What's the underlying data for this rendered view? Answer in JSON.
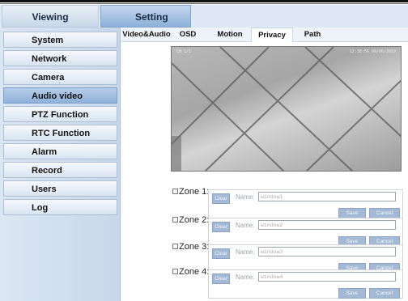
{
  "top_tabs": [
    {
      "label": "Viewing"
    },
    {
      "label": "Setting"
    }
  ],
  "sidebar": {
    "items": [
      {
        "label": "System"
      },
      {
        "label": "Network"
      },
      {
        "label": "Camera"
      },
      {
        "label": "Audio video",
        "active": true
      },
      {
        "label": "PTZ Function"
      },
      {
        "label": "RTC Function"
      },
      {
        "label": "Alarm"
      },
      {
        "label": "Record"
      },
      {
        "label": "Users"
      },
      {
        "label": "Log"
      }
    ]
  },
  "sub_tabs": [
    {
      "label": "Video&Audio"
    },
    {
      "label": "OSD"
    },
    {
      "label": "Motion"
    },
    {
      "label": "Privacy",
      "active": true
    },
    {
      "label": "Path"
    }
  ],
  "video": {
    "osd_left": "CH 1/1",
    "osd_right": "12:38:56 09/06/2019"
  },
  "zones": [
    {
      "label": "Zone 1:",
      "clear": "Clear",
      "name_label": "Name:",
      "name_value": "window1",
      "save": "Save",
      "cancel": "Cancel"
    },
    {
      "label": "Zone 2:",
      "clear": "Clear",
      "name_label": "Name:",
      "name_value": "window2",
      "save": "Save",
      "cancel": "Cancel"
    },
    {
      "label": "Zone 3:",
      "clear": "Clear",
      "name_label": "Name:",
      "name_value": "window3",
      "save": "Save",
      "cancel": "Cancel"
    },
    {
      "label": "Zone 4:",
      "clear": "Clear",
      "name_label": "Name:",
      "name_value": "window4",
      "save": "Save",
      "cancel": "Cancel"
    }
  ]
}
